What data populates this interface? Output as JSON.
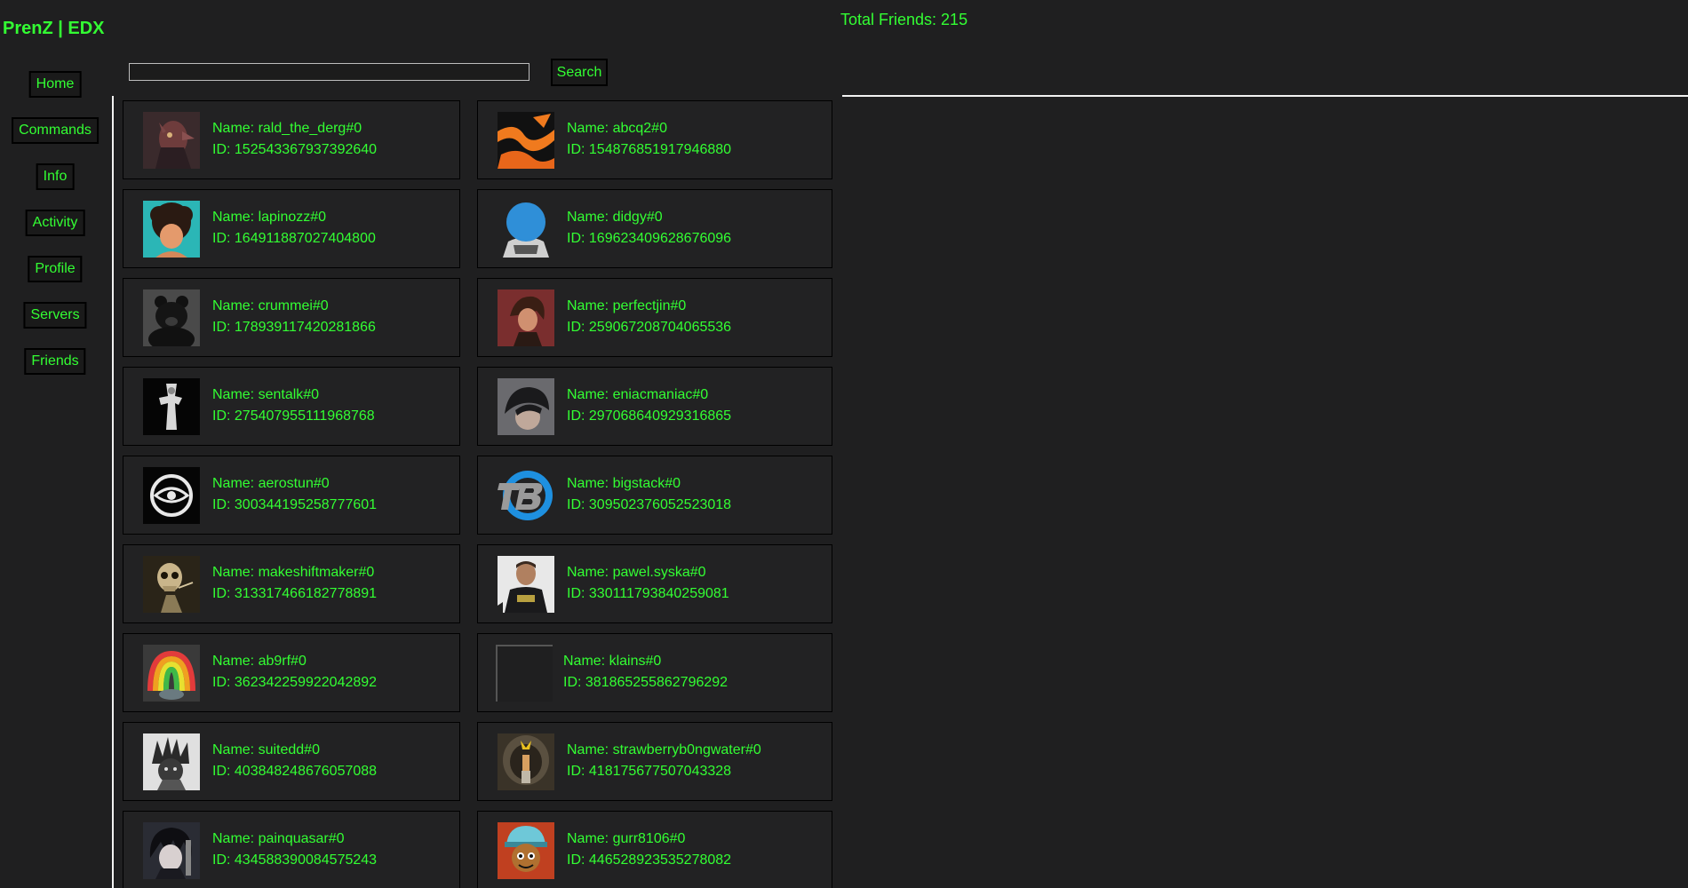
{
  "app": {
    "title": "PrenZ | EDX"
  },
  "stats": {
    "total_friends": "Total Friends: 215"
  },
  "nav": {
    "items": [
      {
        "label": "Home",
        "icon": "none"
      },
      {
        "label": "Commands",
        "icon": "none"
      },
      {
        "label": "Info",
        "icon": "none"
      },
      {
        "label": "Activity",
        "icon": "none"
      },
      {
        "label": "Profile",
        "icon": "none"
      },
      {
        "label": "Servers",
        "icon": "none"
      },
      {
        "label": "Friends",
        "icon": "none"
      }
    ]
  },
  "search": {
    "value": "",
    "button_label": "Search"
  },
  "colors": {
    "accent": "#33ff33",
    "background": "#1f1f20",
    "card": "#222223",
    "divider": "#f2f2f2"
  },
  "friends": [
    {
      "name": "Name: rald_the_derg#0",
      "id": "ID: 152543367937392640",
      "avatar": "dragon-portrait-avatar"
    },
    {
      "name": "Name: abcq2#0",
      "id": "ID: 154876851917946880",
      "avatar": "orange-crane-avatar"
    },
    {
      "name": "Name: lapinozz#0",
      "id": "ID: 164911887027404800",
      "avatar": "afro-cartoon-avatar"
    },
    {
      "name": "Name: didgy#0",
      "id": "ID: 169623409628676096",
      "avatar": "blue-circle-avatar"
    },
    {
      "name": "Name: crummei#0",
      "id": "ID: 178939117420281866",
      "avatar": "black-bear-avatar"
    },
    {
      "name": "Name: perfectjin#0",
      "id": "ID: 259067208704065536",
      "avatar": "red-anime-avatar"
    },
    {
      "name": "Name: sentalk#0",
      "id": "ID: 275407955111968768",
      "avatar": "dark-figure-avatar"
    },
    {
      "name": "Name: eniacmaniac#0",
      "id": "ID: 297068640929316865",
      "avatar": "dark-hair-avatar"
    },
    {
      "name": "Name: aerostun#0",
      "id": "ID: 300344195258777601",
      "avatar": "eye-logo-avatar"
    },
    {
      "name": "Name: bigstack#0",
      "id": "ID: 309502376052523018",
      "avatar": "b-logo-avatar"
    },
    {
      "name": "Name: makeshiftmaker#0",
      "id": "ID: 313317466182778891",
      "avatar": "skeleton-avatar"
    },
    {
      "name": "Name: pawel.syska#0",
      "id": "ID: 330111793840259081",
      "avatar": "person-photo-avatar"
    },
    {
      "name": "Name: ab9rf#0",
      "id": "ID: 362342259922042892",
      "avatar": "rainbow-spiral-avatar"
    },
    {
      "name": "Name: klains#0",
      "id": "ID: 381865255862796292",
      "avatar": "empty-avatar"
    },
    {
      "name": "Name: suitedd#0",
      "id": "ID: 403848248676057088",
      "avatar": "spiky-sketch-avatar"
    },
    {
      "name": "Name: strawberryb0ngwater#0",
      "id": "ID: 418175677507043328",
      "avatar": "tunnel-figure-avatar"
    },
    {
      "name": "Name: painquasar#0",
      "id": "ID: 434588390084575243",
      "avatar": "anime-boy-avatar"
    },
    {
      "name": "Name: gurr8106#0",
      "id": "ID: 446528923535278082",
      "avatar": "cartoon-cap-avatar"
    }
  ]
}
